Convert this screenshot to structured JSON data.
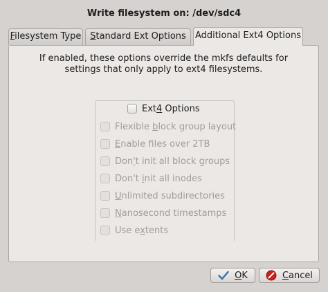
{
  "dialog": {
    "title": "Write filesystem on: /dev/sdc4"
  },
  "tabs": [
    {
      "label_prefix": "",
      "mnemonic": "F",
      "label_rest": "ilesystem Type"
    },
    {
      "label_prefix": "",
      "mnemonic": "S",
      "label_rest": "tandard Ext Options"
    },
    {
      "label_prefix": "Additional Ext4 Options",
      "mnemonic": "",
      "label_rest": ""
    }
  ],
  "panel": {
    "description_line1": "If enabled, these options override the mkfs defaults for",
    "description_line2": "settings that only apply to ext4 filesystems."
  },
  "ext4_group": {
    "enable_checkbox": {
      "prefix": "Ext",
      "mnemonic": "4",
      "rest": " Options",
      "checked": false
    },
    "options": [
      {
        "prefix": "Flexible ",
        "mnemonic": "b",
        "rest": "lock group layout",
        "checked": false
      },
      {
        "prefix": "",
        "mnemonic": "E",
        "rest": "nable files over 2TB",
        "checked": false
      },
      {
        "prefix": "Don",
        "mnemonic": "'",
        "rest": "t init all block groups",
        "checked": false
      },
      {
        "prefix": "Don't ",
        "mnemonic": "i",
        "rest": "nit all inodes",
        "checked": false
      },
      {
        "prefix": "",
        "mnemonic": "U",
        "rest": "nlimited subdirectories",
        "checked": false
      },
      {
        "prefix": "",
        "mnemonic": "N",
        "rest": "anosecond timestamps",
        "checked": false
      },
      {
        "prefix": "Use e",
        "mnemonic": "x",
        "rest": "tents",
        "checked": false
      }
    ]
  },
  "buttons": {
    "ok": {
      "mnemonic": "O",
      "rest": "K"
    },
    "cancel": {
      "mnemonic": "C",
      "rest": "ancel"
    }
  },
  "colors": {
    "window_bg": "#d6d2d0",
    "panel_bg": "#ebe8e6",
    "disabled_text": "#a09c99",
    "ok_icon": "#3a6ea5",
    "cancel_icon": "#c8201a"
  },
  "icons": {
    "ok": "checkmark-icon",
    "cancel": "cancel-circle-icon"
  }
}
